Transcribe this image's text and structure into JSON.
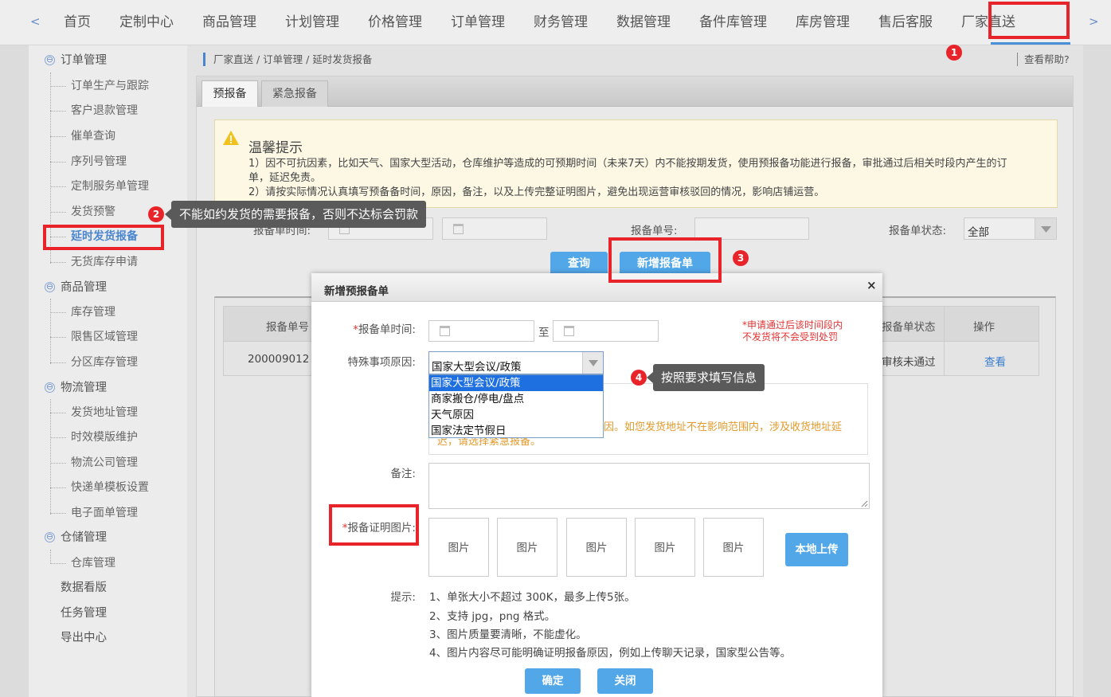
{
  "nav": {
    "prev_arrow": "<",
    "next_arrow": ">",
    "items": [
      "首页",
      "定制中心",
      "商品管理",
      "计划管理",
      "价格管理",
      "订单管理",
      "财务管理",
      "数据管理",
      "备件库管理",
      "库房管理",
      "售后客服",
      "厂家直送"
    ],
    "active": "厂家直送"
  },
  "sidebar": {
    "groups": [
      {
        "label": "订单管理",
        "collapse_icon": "⊖",
        "items": [
          "订单生产与跟踪",
          "客户退款管理",
          "催单查询",
          "序列号管理",
          "定制服务单管理",
          "发货预警",
          "延时发货报备",
          "无货库存申请"
        ],
        "active": "延时发货报备"
      },
      {
        "label": "商品管理",
        "collapse_icon": "⊖",
        "items": [
          "库存管理",
          "限售区域管理",
          "分区库存管理"
        ]
      },
      {
        "label": "物流管理",
        "collapse_icon": "⊖",
        "items": [
          "发货地址管理",
          "时效模版维护",
          "物流公司管理",
          "快递单模板设置",
          "电子面单管理"
        ]
      },
      {
        "label": "仓储管理",
        "collapse_icon": "⊖",
        "items": [
          "仓库管理"
        ]
      }
    ],
    "extra": [
      "数据看版",
      "任务管理",
      "导出中心"
    ]
  },
  "breadcrumb": "厂家直送 / 订单管理 / 延时发货报备",
  "help": "查看帮助?",
  "tabs": [
    {
      "label": "预报备",
      "selected": true
    },
    {
      "label": "紧急报备",
      "selected": false
    }
  ],
  "notice": {
    "title": "温馨提示",
    "lines": [
      "1）因不可抗因素，比如天气、国家大型活动，仓库维护等造成的可预期时间（未来7天）内不能按期发货，使用预报备功能进行报备，审批通过后相关时段内产生的订",
      "单，延迟免责。",
      "2）请按实际情况认真填写预备备时间，原因，备注，以及上传完整证明图片，避免出现运营审核驳回的情况，影响店铺运营。"
    ]
  },
  "filters": {
    "time_label": "报备单时间:",
    "number_label": "报备单号:",
    "status_label": "报备单状态:",
    "status_value": "全部",
    "query_button": "查询",
    "add_button": "新增报备单"
  },
  "table": {
    "col_number": "报备单号",
    "col_status": "报备单状态",
    "col_action": "操作",
    "row_number": "200009012",
    "row_status": "审核未通过",
    "row_action": "查看"
  },
  "modal": {
    "title": "新增预报备单",
    "close": "×",
    "time_label": "报备单时间:",
    "to": "至",
    "red_note": [
      "*申请通过后该时间段内",
      "不发货将不会受到处罚"
    ],
    "reason_label": "特殊事项原因:",
    "reason_value": "国家大型会议/政策",
    "reason_options": [
      "国家大型会议/政策",
      "商家搬仓/停电/盘点",
      "天气原因",
      "国家法定节假日"
    ],
    "hint_visible": "因。如您发货地址不在影响范围内，涉及收货地址延",
    "hint_visible2": "迟，请选择紧急报备。",
    "remark_label": "备注:",
    "pic_label": "报备证明图片:",
    "pic_slot": "图片",
    "upload_button": "本地上传",
    "tips_label": "提示:",
    "tips": [
      "1、单张大小不超过 300K，最多上传5张。",
      "2、支持 jpg，png 格式。",
      "3、图片质量要清晰，不能虚化。",
      "4、图片内容尽可能明确证明报备原因，例如上传聊天记录，国家型公告等。"
    ],
    "confirm_button": "确定",
    "cancel_button": "关闭"
  },
  "annotations": {
    "badge1": "1",
    "badge2": "2",
    "badge3": "3",
    "badge4": "4",
    "tooltip2": "不能如约发货的需要报备，否则不达标会罚款",
    "tooltip4": "按照要求填写信息"
  }
}
